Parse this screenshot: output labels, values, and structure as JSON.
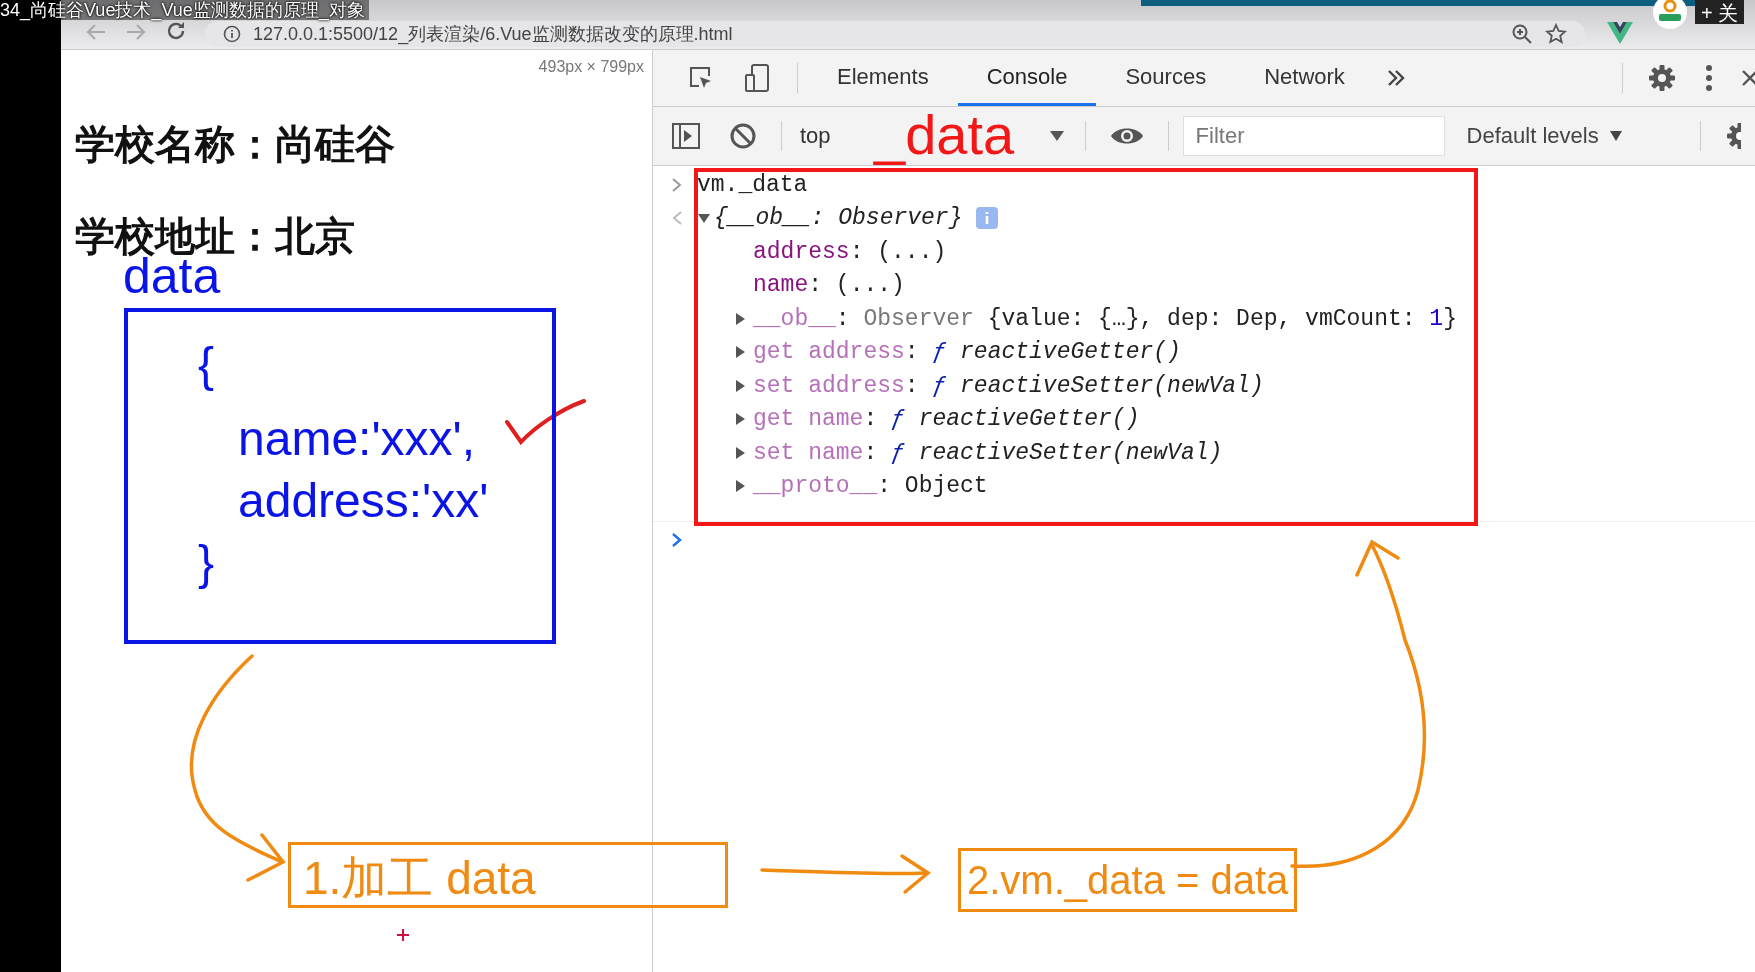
{
  "video_title": "34_尚硅谷Vue技术_Vue监测数据的原理_对象",
  "follow_button": "+ 关",
  "address_bar": {
    "url": "127.0.0.1:5500/12_列表渲染/6.Vue监测数据改变的原理.html"
  },
  "page": {
    "size_badge": "493px × 799px",
    "headings": [
      "学校名称：尚硅谷",
      "学校地址：北京"
    ]
  },
  "devtools": {
    "tabs": [
      {
        "label": "Elements",
        "selected": false
      },
      {
        "label": "Console",
        "selected": true
      },
      {
        "label": "Sources",
        "selected": false
      },
      {
        "label": "Network",
        "selected": false
      }
    ],
    "context": "top",
    "filter": {
      "placeholder": "Filter"
    },
    "levels": "Default levels"
  },
  "console": {
    "input": "vm._data",
    "result": {
      "expanded": true,
      "segments": [
        {
          "text": "{__ob__: Observer}",
          "kind": "italic"
        }
      ],
      "children": [
        {
          "kind": "value",
          "segments": [
            {
              "text": "address",
              "kind": "key"
            },
            {
              "text": ": (...)",
              "kind": "plain"
            }
          ]
        },
        {
          "kind": "value",
          "segments": [
            {
              "text": "name",
              "kind": "key"
            },
            {
              "text": ": (...)",
              "kind": "plain"
            }
          ]
        },
        {
          "kind": "node",
          "expanded": false,
          "segments": [
            {
              "text": "__ob__",
              "kind": "faded"
            },
            {
              "text": ": ",
              "kind": "plain"
            },
            {
              "text": "Observer ",
              "kind": "gray"
            },
            {
              "text": "{value: {…}, dep: Dep, vmCount: ",
              "kind": "plain"
            },
            {
              "text": "1",
              "kind": "number"
            },
            {
              "text": "}",
              "kind": "plain"
            }
          ]
        },
        {
          "kind": "node",
          "expanded": false,
          "segments": [
            {
              "text": "get address",
              "kind": "faded"
            },
            {
              "text": ": ",
              "kind": "plain"
            },
            {
              "text": "ƒ ",
              "kind": "fn"
            },
            {
              "text": "reactiveGetter()",
              "kind": "italic"
            }
          ]
        },
        {
          "kind": "node",
          "expanded": false,
          "segments": [
            {
              "text": "set address",
              "kind": "faded"
            },
            {
              "text": ": ",
              "kind": "plain"
            },
            {
              "text": "ƒ ",
              "kind": "fn"
            },
            {
              "text": "reactiveSetter(newVal)",
              "kind": "italic"
            }
          ]
        },
        {
          "kind": "node",
          "expanded": false,
          "segments": [
            {
              "text": "get name",
              "kind": "faded"
            },
            {
              "text": ": ",
              "kind": "plain"
            },
            {
              "text": "ƒ ",
              "kind": "fn"
            },
            {
              "text": "reactiveGetter()",
              "kind": "italic"
            }
          ]
        },
        {
          "kind": "node",
          "expanded": false,
          "segments": [
            {
              "text": "set name",
              "kind": "faded"
            },
            {
              "text": ": ",
              "kind": "plain"
            },
            {
              "text": "ƒ ",
              "kind": "fn"
            },
            {
              "text": "reactiveSetter(newVal)",
              "kind": "italic"
            }
          ]
        },
        {
          "kind": "node",
          "expanded": false,
          "segments": [
            {
              "text": "__proto__",
              "kind": "faded"
            },
            {
              "text": ": Object",
              "kind": "plain"
            }
          ]
        }
      ]
    }
  },
  "annotations": {
    "toolbar_note": "_data",
    "data_label": "data",
    "data_code": [
      {
        "kind": "brace",
        "text": "{"
      },
      {
        "kind": "entry",
        "text": "name:'xxx',"
      },
      {
        "kind": "entry",
        "text": "address:'xx'"
      },
      {
        "kind": "brace",
        "text": "}"
      }
    ],
    "steps": [
      "1.加工 data",
      "2.vm._data = data"
    ]
  }
}
